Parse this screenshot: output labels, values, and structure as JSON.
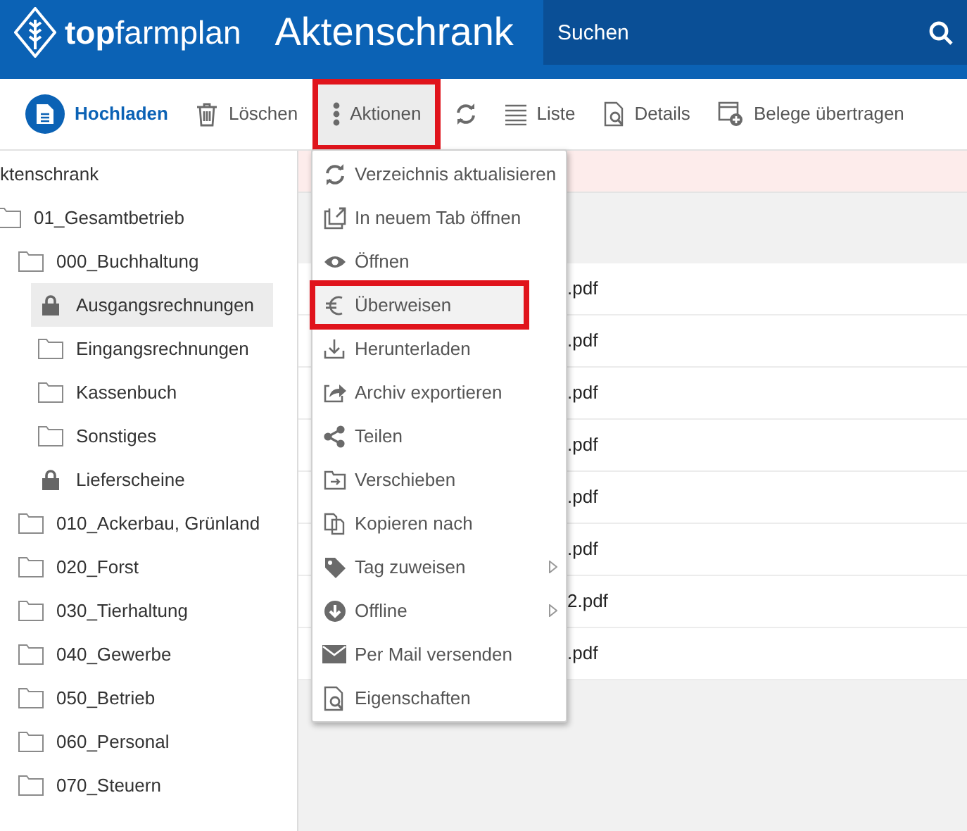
{
  "header": {
    "brand_bold": "top",
    "brand_rest": "farmplan",
    "title": "Aktenschrank",
    "search": {
      "placeholder": "Suchen"
    }
  },
  "toolbar": [
    {
      "kind": "primary",
      "label": "Hochladen",
      "highlighted": false
    },
    {
      "kind": "plain",
      "label": "Löschen",
      "highlighted": false
    },
    {
      "kind": "plain",
      "label": "Aktionen",
      "highlighted": true
    },
    {
      "kind": "plain",
      "highlighted": false
    },
    {
      "kind": "plain",
      "label": "Liste",
      "highlighted": false
    },
    {
      "kind": "plain",
      "label": "Details",
      "highlighted": false
    },
    {
      "kind": "plain",
      "label": "Belege übertragen",
      "highlighted": false
    }
  ],
  "tree": {
    "label": "ktenschrank",
    "children": [
      {
        "label": "01_Gesamtbetrieb",
        "kind": "folder",
        "selected": false,
        "children": [
          {
            "label": "000_Buchhaltung",
            "kind": "folder",
            "selected": false,
            "children": [
              {
                "label": "Ausgangsrechnungen",
                "kind": "locked",
                "selected": true
              },
              {
                "label": "Eingangsrechnungen",
                "kind": "folder",
                "selected": false
              },
              {
                "label": "Kassenbuch",
                "kind": "folder",
                "selected": false
              },
              {
                "label": "Sonstiges",
                "kind": "folder",
                "selected": false
              },
              {
                "label": "Lieferscheine",
                "kind": "locked",
                "selected": false
              }
            ]
          },
          {
            "label": "010_Ackerbau, Grünland",
            "kind": "folder",
            "selected": false
          },
          {
            "label": "020_Forst",
            "kind": "folder",
            "selected": false
          },
          {
            "label": "030_Tierhaltung",
            "kind": "folder",
            "selected": false
          },
          {
            "label": "040_Gewerbe",
            "kind": "folder",
            "selected": false
          },
          {
            "label": "050_Betrieb",
            "kind": "folder",
            "selected": false
          },
          {
            "label": "060_Personal",
            "kind": "folder",
            "selected": false
          },
          {
            "label": "070_Steuern",
            "kind": "folder",
            "selected": false
          }
        ]
      }
    ]
  },
  "files": [
    {
      "name": ".pdf"
    },
    {
      "name": ".pdf"
    },
    {
      "name": ".pdf"
    },
    {
      "name": ".pdf"
    },
    {
      "name": ".pdf"
    },
    {
      "name": ".pdf"
    },
    {
      "name": "2.pdf"
    },
    {
      "name": ".pdf"
    }
  ],
  "menu": [
    {
      "label": "Verzeichnis aktualisieren",
      "highlighted": false,
      "submenu": false
    },
    {
      "label": "In neuem Tab öffnen",
      "highlighted": false,
      "submenu": false
    },
    {
      "label": "Öffnen",
      "highlighted": false,
      "submenu": false
    },
    {
      "label": "Überweisen",
      "highlighted": true,
      "submenu": false
    },
    {
      "label": "Herunterladen",
      "highlighted": false,
      "submenu": false
    },
    {
      "label": "Archiv exportieren",
      "highlighted": false,
      "submenu": false
    },
    {
      "label": "Teilen",
      "highlighted": false,
      "submenu": false
    },
    {
      "label": "Verschieben",
      "highlighted": false,
      "submenu": false
    },
    {
      "label": "Kopieren nach",
      "highlighted": false,
      "submenu": false
    },
    {
      "label": "Tag zuweisen",
      "highlighted": false,
      "submenu": true
    },
    {
      "label": "Offline",
      "highlighted": false,
      "submenu": true
    },
    {
      "label": "Per Mail versenden",
      "highlighted": false,
      "submenu": false
    },
    {
      "label": "Eigenschaften",
      "highlighted": false,
      "submenu": false
    }
  ]
}
